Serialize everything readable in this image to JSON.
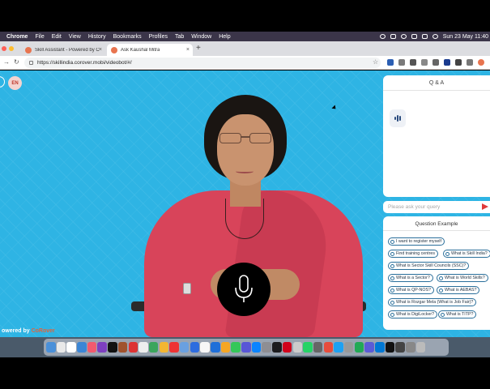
{
  "menubar": {
    "items": [
      "Chrome",
      "File",
      "Edit",
      "View",
      "History",
      "Bookmarks",
      "Profiles",
      "Tab",
      "Window",
      "Help"
    ],
    "datetime": "Sun 23 May  11:40"
  },
  "tabs": [
    {
      "label": "Skill Assistant - Powered by CoRover",
      "active": false
    },
    {
      "label": "Ask Kaushal Mitra",
      "active": true
    }
  ],
  "address": {
    "url": "https://skillindia.corover.mobi/videobot/#/"
  },
  "page": {
    "language_badge": "EN",
    "powered_prefix": "owered by ",
    "powered_brand": "CoRover",
    "qa_title": "Q & A",
    "query_placeholder": "Please ask your query",
    "question_example_title": "Question Example",
    "questions": [
      "I want to register myself",
      "Find training centres",
      "What is Skill India?",
      "What is Sector Skill Councils (SSC)?",
      "What is a Sector?",
      "What is World Skills?",
      "What is QP-NOS?",
      "What is AEBAS?",
      "What is Rozgar Mela (What is Job Fair)?",
      "What is DigiLocker?",
      "What is TITP?"
    ]
  },
  "colors": {
    "page_bg": "#2eb4e4",
    "accent": "#e03a3a",
    "chip_border": "#2a6f9b"
  },
  "icons": [
    "apple-icon",
    "wifi-icon",
    "battery-icon",
    "microphone-icon",
    "send-icon",
    "typing-indicator-icon"
  ]
}
